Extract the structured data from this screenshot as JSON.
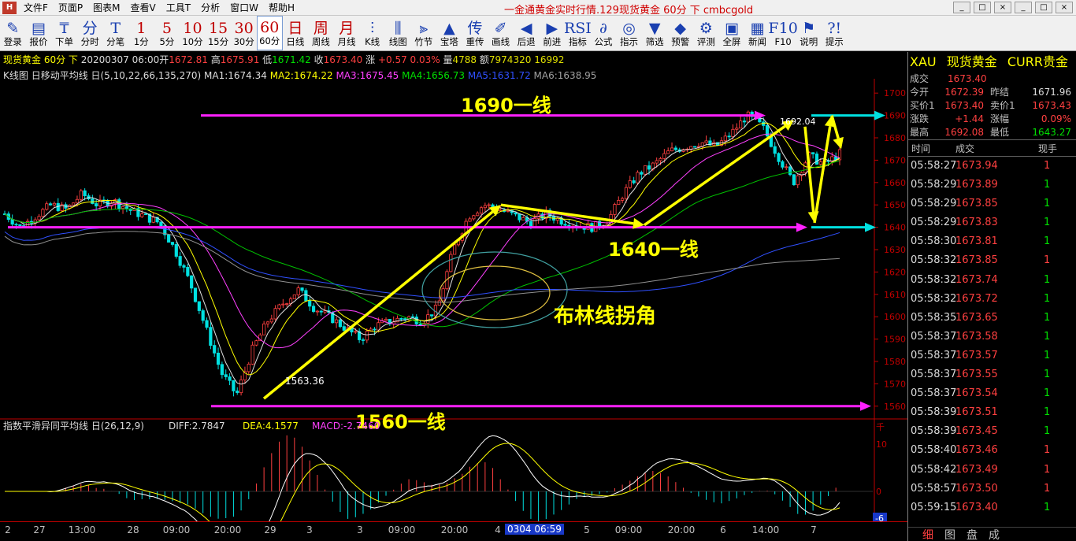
{
  "window": {
    "app_icon_label": "H",
    "title": "一金通黄金实时行情.129现货黄金 60分 下 cmbcgold",
    "controls": [
      "_",
      "□",
      "×",
      "_",
      "□",
      "×"
    ]
  },
  "menu": [
    "文件F",
    "页面P",
    "图表M",
    "查看V",
    "工具T",
    "分析",
    "窗口W",
    "帮助H"
  ],
  "toolbar": [
    {
      "glyph": "✎",
      "label": "登录"
    },
    {
      "glyph": "▤",
      "label": "报价"
    },
    {
      "glyph": "₸",
      "label": "下单"
    },
    {
      "glyph": "分",
      "label": "分时"
    },
    {
      "glyph": "T",
      "label": "分笔"
    },
    {
      "glyph": "1",
      "label": "1分"
    },
    {
      "glyph": "5",
      "label": "5分"
    },
    {
      "glyph": "10",
      "label": "10分"
    },
    {
      "glyph": "15",
      "label": "15分"
    },
    {
      "glyph": "30",
      "label": "30分"
    },
    {
      "glyph": "60",
      "label": "60分",
      "active": true
    },
    {
      "glyph": "日",
      "label": "日线"
    },
    {
      "glyph": "周",
      "label": "周线"
    },
    {
      "glyph": "月",
      "label": "月线"
    },
    {
      "glyph": "⫶",
      "label": "K线"
    },
    {
      "glyph": "⫼",
      "label": "线图"
    },
    {
      "glyph": "⫸",
      "label": "竹节"
    },
    {
      "glyph": "▲",
      "label": "宝塔"
    },
    {
      "glyph": "传",
      "label": "重传"
    },
    {
      "glyph": "✐",
      "label": "画线"
    },
    {
      "glyph": "◀",
      "label": "后退"
    },
    {
      "glyph": "▶",
      "label": "前进"
    },
    {
      "glyph": "RSI",
      "label": "指标"
    },
    {
      "glyph": "∂",
      "label": "公式"
    },
    {
      "glyph": "◎",
      "label": "指示"
    },
    {
      "glyph": "▼",
      "label": "筛选"
    },
    {
      "glyph": "◆",
      "label": "预警"
    },
    {
      "glyph": "⚙",
      "label": "评测"
    },
    {
      "glyph": "▣",
      "label": "全屏"
    },
    {
      "glyph": "▦",
      "label": "新闻"
    },
    {
      "glyph": "F10",
      "label": "F10"
    },
    {
      "glyph": "⚑",
      "label": "说明"
    },
    {
      "glyph": "?!",
      "label": "提示"
    }
  ],
  "info_bar": {
    "symbol": "现货黄金 60分 下",
    "date": "20200307 06:00",
    "open_label": "开",
    "open": "1672.81",
    "high_label": "高",
    "high": "1675.91",
    "low_label": "低",
    "low": "1671.42",
    "close_label": "收",
    "close": "1673.40",
    "change_label": "涨",
    "change": "+0.57",
    "change_pct": "0.03%",
    "volume_label": "量",
    "volume": "4788",
    "amount_label": "额",
    "amount": "7974320",
    "extra": "16992"
  },
  "ma_bar": {
    "prefix": "K线图 ",
    "name": "日移动平均线 日(5,10,22,66,135,270)",
    "ma1": "MA1:1674.34",
    "ma2": "MA2:1674.22",
    "ma3": "MA3:1675.45",
    "ma4": "MA4:1656.73",
    "ma5": "MA5:1631.72",
    "ma6": "MA6:1638.95"
  },
  "macd_bar": {
    "name": "指数平滑异同平均线 日(26,12,9)",
    "diff": "DIFF:2.7847",
    "dea": "DEA:4.1577",
    "macd": "MACD:-2.7460"
  },
  "annotations": {
    "line_1690": "1690一线",
    "line_1640": "1640一线",
    "line_1560": "1560一线",
    "bollinger": "布林线拐角",
    "low_label": "1563.36",
    "high_label": "1692.04"
  },
  "price_axis": [
    "1700",
    "1690",
    "1680",
    "1670",
    "1660",
    "1650",
    "1640",
    "1630",
    "1620",
    "1610",
    "1600",
    "1590",
    "1580",
    "1570",
    "1560"
  ],
  "macd_axis": {
    "unit": "千",
    "top": "10",
    "zero": "0",
    "low": "-6"
  },
  "time_axis": {
    "labels": [
      {
        "text": "2",
        "x": 10
      },
      {
        "text": "27",
        "x": 50
      },
      {
        "text": "13:00",
        "x": 104
      },
      {
        "text": "28",
        "x": 169
      },
      {
        "text": "09:00",
        "x": 224
      },
      {
        "text": "20:00",
        "x": 289
      },
      {
        "text": "29",
        "x": 343
      },
      {
        "text": "3",
        "x": 393
      },
      {
        "text": "3",
        "x": 457
      },
      {
        "text": "09:00",
        "x": 510
      },
      {
        "text": "20:00",
        "x": 577
      },
      {
        "text": "4",
        "x": 632
      },
      {
        "text": "5",
        "x": 745
      },
      {
        "text": "09:00",
        "x": 798
      },
      {
        "text": "20:00",
        "x": 865
      },
      {
        "text": "6",
        "x": 918
      },
      {
        "text": "14:00",
        "x": 972
      },
      {
        "text": "7",
        "x": 1033
      }
    ],
    "cursor": "0304 06:59"
  },
  "quote_panel": {
    "code": "XAU",
    "name": "现货黄金",
    "market": "CURR贵金",
    "rows": [
      {
        "l1": "成交",
        "v1": "1673.40",
        "c1": "#ff4040"
      },
      {
        "l1": "今开",
        "v1": "1672.39",
        "c1": "#ff4040",
        "l2": "昨结",
        "v2": "1671.96",
        "c2": "#dcdcdc"
      },
      {
        "l1": "买价1",
        "v1": "1673.40",
        "c1": "#ff4040",
        "l2": "卖价1",
        "v2": "1673.43",
        "c2": "#ff4040"
      },
      {
        "l1": "涨跌",
        "v1": "+1.44",
        "c1": "#ff4040",
        "l2": "涨幅",
        "v2": "0.09%",
        "c2": "#ff4040"
      },
      {
        "l1": "最高",
        "v1": "1692.08",
        "c1": "#ff4040",
        "l2": "最低",
        "v2": "1643.27",
        "c2": "#00e000"
      }
    ],
    "tick_header": [
      "时间",
      "成交",
      "现手"
    ],
    "ticks": [
      {
        "time": "05:58:27",
        "price": "1673.94",
        "vol": "1",
        "vc": "#ff4040"
      },
      {
        "time": "05:58:29",
        "price": "1673.89",
        "vol": "1",
        "vc": "#00e000"
      },
      {
        "time": "05:58:29",
        "price": "1673.85",
        "vol": "1",
        "vc": "#00e000"
      },
      {
        "time": "05:58:29",
        "price": "1673.83",
        "vol": "1",
        "vc": "#00e000"
      },
      {
        "time": "05:58:30",
        "price": "1673.81",
        "vol": "1",
        "vc": "#00e000"
      },
      {
        "time": "05:58:32",
        "price": "1673.85",
        "vol": "1",
        "vc": "#ff4040"
      },
      {
        "time": "05:58:32",
        "price": "1673.74",
        "vol": "1",
        "vc": "#00e000"
      },
      {
        "time": "05:58:32",
        "price": "1673.72",
        "vol": "1",
        "vc": "#00e000"
      },
      {
        "time": "05:58:35",
        "price": "1673.65",
        "vol": "1",
        "vc": "#00e000"
      },
      {
        "time": "05:58:37",
        "price": "1673.58",
        "vol": "1",
        "vc": "#00e000"
      },
      {
        "time": "05:58:37",
        "price": "1673.57",
        "vol": "1",
        "vc": "#00e000"
      },
      {
        "time": "05:58:37",
        "price": "1673.55",
        "vol": "1",
        "vc": "#00e000"
      },
      {
        "time": "05:58:37",
        "price": "1673.54",
        "vol": "1",
        "vc": "#00e000"
      },
      {
        "time": "05:58:39",
        "price": "1673.51",
        "vol": "1",
        "vc": "#00e000"
      },
      {
        "time": "05:58:39",
        "price": "1673.45",
        "vol": "1",
        "vc": "#00e000"
      },
      {
        "time": "05:58:40",
        "price": "1673.46",
        "vol": "1",
        "vc": "#ff4040"
      },
      {
        "time": "05:58:42",
        "price": "1673.49",
        "vol": "1",
        "vc": "#ff4040"
      },
      {
        "time": "05:58:57",
        "price": "1673.50",
        "vol": "1",
        "vc": "#ff4040"
      },
      {
        "time": "05:59:15",
        "price": "1673.40",
        "vol": "1",
        "vc": "#00e000"
      }
    ],
    "tabs": [
      "细",
      "图",
      "盘",
      "成"
    ]
  },
  "colors": {
    "up": "#ff4040",
    "down": "#00e0e0",
    "annotation_yellow": "#ffff00",
    "arrow_magenta": "#ff20ff",
    "arrow_cyan": "#00e0e0"
  },
  "chart_data": {
    "type": "line",
    "symbol": "XAU",
    "timeframe": "60分",
    "price_range": [
      1555,
      1705
    ],
    "swing_points": [
      {
        "label": "low",
        "price": 1563.36
      },
      {
        "label": "high",
        "price": 1692.04
      }
    ],
    "reference_levels": [
      1690,
      1640,
      1560
    ],
    "price_path": [
      1646,
      1640,
      1645,
      1650,
      1648,
      1655,
      1650,
      1652,
      1648,
      1645,
      1642,
      1630,
      1615,
      1595,
      1575,
      1565,
      1585,
      1598,
      1606,
      1612,
      1604,
      1600,
      1595,
      1590,
      1596,
      1598,
      1600,
      1598,
      1604,
      1630,
      1645,
      1650,
      1648,
      1645,
      1642,
      1646,
      1643,
      1641,
      1640,
      1643,
      1655,
      1664,
      1668,
      1674,
      1676,
      1678,
      1676,
      1682,
      1690,
      1685,
      1672,
      1660,
      1672,
      1668,
      1673
    ],
    "ma_lines": {
      "MA1": 1674.34,
      "MA2": 1674.22,
      "MA3": 1675.45,
      "MA4": 1656.73,
      "MA5": 1631.72,
      "MA6": 1638.95
    },
    "macd": {
      "DIFF": 2.7847,
      "DEA": 4.1577,
      "MACD": -2.746,
      "ylim": [
        -6,
        12
      ]
    }
  }
}
